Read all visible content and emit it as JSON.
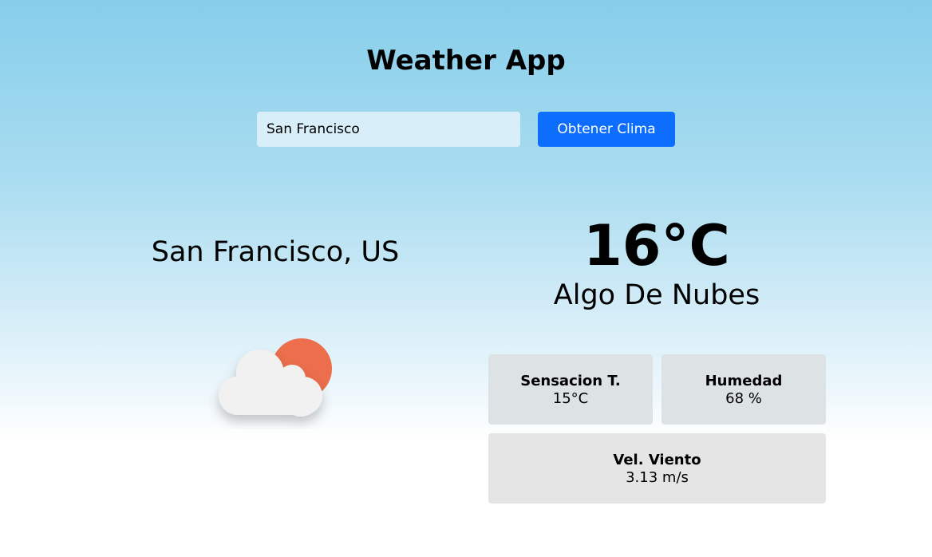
{
  "header": {
    "title": "Weather App"
  },
  "search": {
    "value": "San Francisco",
    "button_label": "Obtener Clima"
  },
  "location": {
    "city": "San Francisco, US"
  },
  "current": {
    "temperature": "16°C",
    "condition": "Algo De Nubes",
    "icon": "partly-cloudy-icon"
  },
  "stats": {
    "feels_like": {
      "label": "Sensacion T.",
      "value": "15°C"
    },
    "humidity": {
      "label": "Humedad",
      "value": "68 %"
    },
    "wind": {
      "label": "Vel. Viento",
      "value": "3.13 m/s"
    }
  },
  "colors": {
    "button": "#0d6efd",
    "sun": "#ec6e4c",
    "cloud": "#f1f1f2",
    "sky_top": "#87ceeb"
  }
}
